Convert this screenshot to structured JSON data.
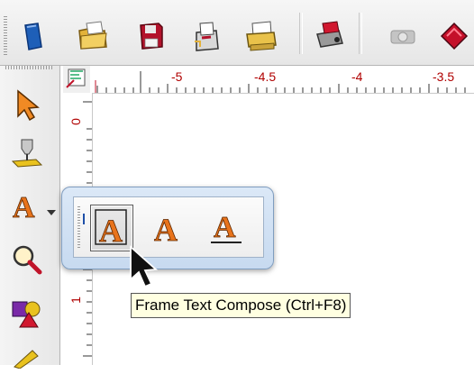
{
  "toolbar": {
    "buttons": [
      {
        "icon": "new-document-icon"
      },
      {
        "icon": "open-folder-icon"
      },
      {
        "icon": "save-icon"
      },
      {
        "icon": "import-icon"
      },
      {
        "icon": "print-icon"
      },
      {
        "icon": "output-device-icon"
      },
      {
        "icon": "vinyl-cutter-icon"
      },
      {
        "icon": "plot-icon"
      }
    ]
  },
  "ruler": {
    "horizontal_labels": [
      "-5",
      "-4.5",
      "-4",
      "-3.5"
    ],
    "vertical_labels": [
      "0",
      "1"
    ]
  },
  "toolbox": {
    "tools": [
      {
        "icon": "pointer-icon"
      },
      {
        "icon": "cutter-tool-icon"
      },
      {
        "icon": "text-tool-icon"
      },
      {
        "icon": "zoom-icon"
      },
      {
        "icon": "shapes-icon"
      },
      {
        "icon": "pencil-icon"
      }
    ]
  },
  "flyout": {
    "items": [
      {
        "icon": "frame-text-icon",
        "active": true
      },
      {
        "icon": "text-icon",
        "active": false
      },
      {
        "icon": "underlined-text-icon",
        "active": false
      }
    ]
  },
  "tooltip": {
    "text": "Frame Text Compose (Ctrl+F8)"
  },
  "colors": {
    "flyout_bg": "#c7daf0",
    "tooltip_bg": "#ffffe1",
    "text_orange": "#e8731b"
  }
}
